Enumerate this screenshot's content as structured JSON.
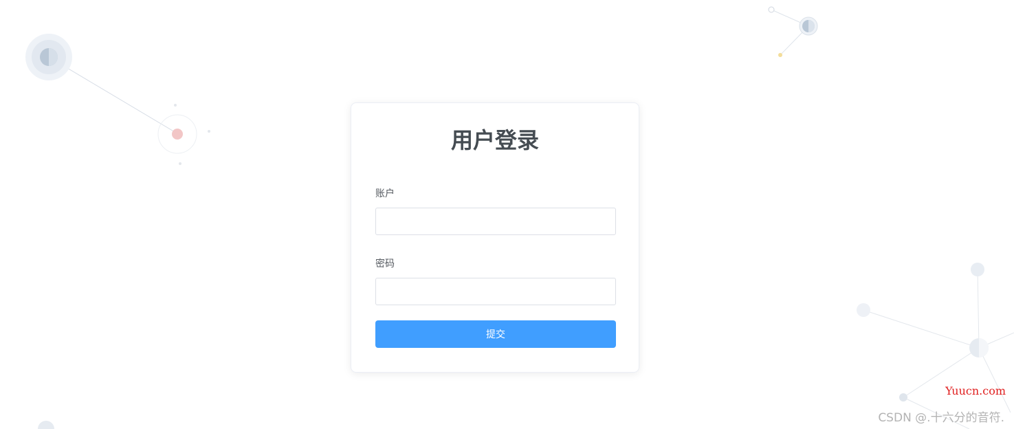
{
  "login": {
    "title": "用户登录",
    "account_label": "账户",
    "account_value": "",
    "password_label": "密码",
    "password_value": "",
    "submit_label": "提交"
  },
  "watermarks": {
    "site": "Yuucn.com",
    "csdn": "CSDN @.十六分的音符."
  },
  "colors": {
    "primary": "#409eff",
    "title": "#454c52",
    "background": "#ffffff"
  }
}
